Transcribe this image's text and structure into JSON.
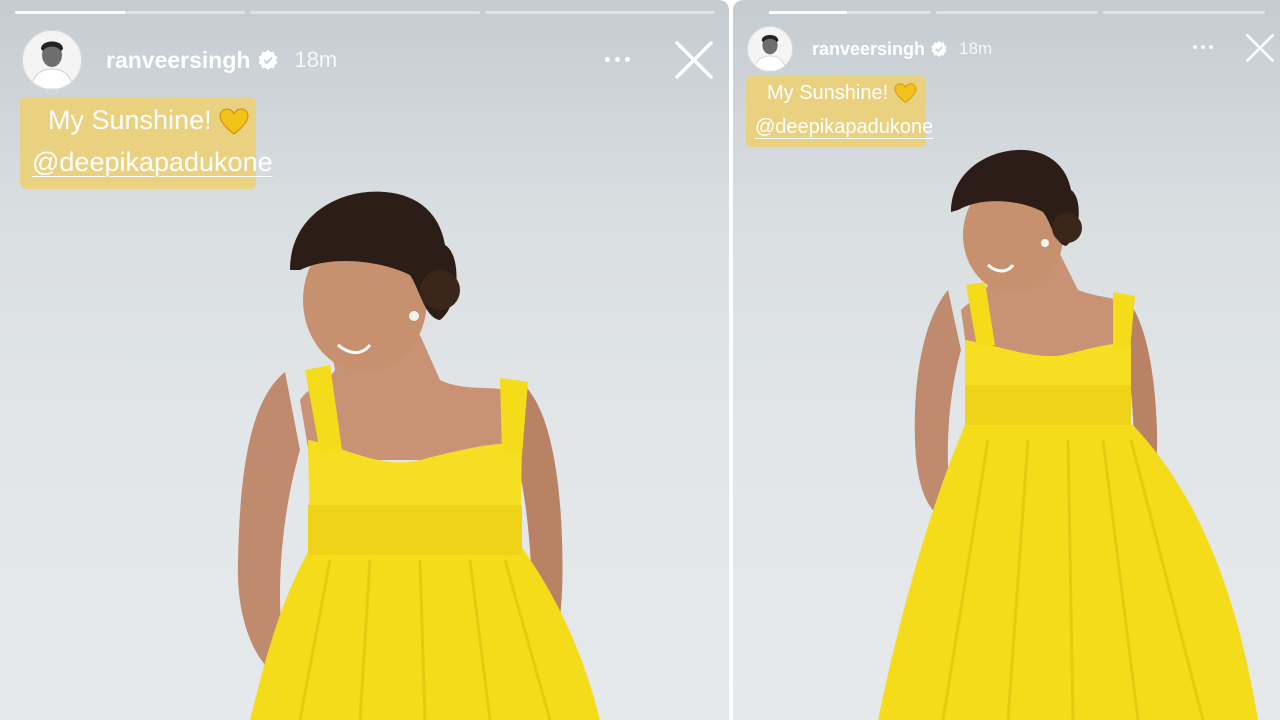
{
  "stories": [
    {
      "id": "left",
      "progress": [
        0.48,
        0,
        0
      ],
      "username": "ranveersingh",
      "verified": true,
      "time": "18m",
      "caption": {
        "line1": "My Sunshine!",
        "emoji": "yellow-heart",
        "mention": "@deepikapadukone"
      },
      "colors": {
        "caption_bg": "#ecd078",
        "dress": "#f5dd1a",
        "background": "#e2e6e8"
      }
    },
    {
      "id": "right",
      "progress": [
        0.48,
        0,
        0
      ],
      "username": "ranveersingh",
      "verified": true,
      "time": "18m",
      "caption": {
        "line1": "My Sunshine!",
        "emoji": "yellow-heart",
        "mention": "@deepikapadukone"
      },
      "colors": {
        "caption_bg": "#ecd078",
        "dress": "#f5dd1a",
        "background": "#e2e6e8"
      }
    }
  ],
  "icons": {
    "verified": "verified-badge-icon",
    "more": "more-options-icon",
    "close": "close-icon",
    "heart": "yellow-heart-icon"
  }
}
